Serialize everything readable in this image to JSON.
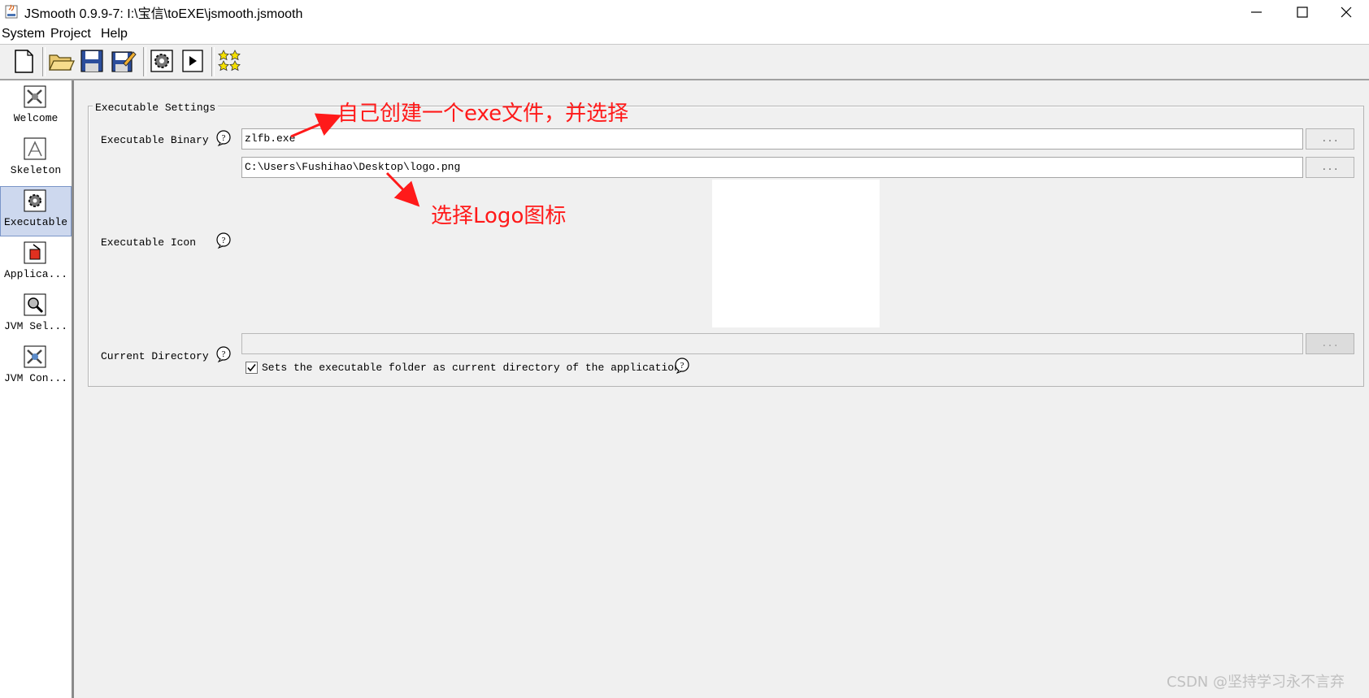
{
  "window": {
    "title": "JSmooth 0.9.9-7: I:\\宝信\\toEXE\\jsmooth.jsmooth",
    "controls": [
      "minimize",
      "maximize",
      "close"
    ]
  },
  "menu": {
    "items": [
      {
        "label": "System"
      },
      {
        "label": "Project"
      },
      {
        "label": "Help"
      }
    ]
  },
  "toolbar": {
    "buttons": [
      {
        "name": "new-file-icon"
      },
      {
        "name": "open-folder-icon"
      },
      {
        "name": "save-icon"
      },
      {
        "name": "save-as-icon"
      },
      {
        "name": "compile-gear-icon"
      },
      {
        "name": "run-icon"
      },
      {
        "name": "about-stars-icon"
      }
    ]
  },
  "sidebar": {
    "items": [
      {
        "label": "Welcome",
        "icon": "welcome-icon",
        "active": false
      },
      {
        "label": "Skeleton",
        "icon": "skeleton-icon",
        "active": false
      },
      {
        "label": "Executable",
        "icon": "executable-gear-icon",
        "active": true
      },
      {
        "label": "Applica...",
        "icon": "application-icon",
        "active": false
      },
      {
        "label": "JVM Sel...",
        "icon": "jvm-selection-icon",
        "active": false
      },
      {
        "label": "JVM Con...",
        "icon": "jvm-config-icon",
        "active": false
      }
    ]
  },
  "executable_settings": {
    "legend": "Executable Settings",
    "binary": {
      "label": "Executable Binary",
      "value": "zlfb.exe",
      "browse_label": "..."
    },
    "icon": {
      "label": "Executable Icon",
      "value": "C:\\Users\\Fushihao\\Desktop\\logo.png",
      "browse_label": "..."
    },
    "current_directory": {
      "label": "Current Directory",
      "value": "",
      "browse_label": "...",
      "checkbox_label": "Sets the executable folder as current directory of the application.",
      "checked": true
    }
  },
  "annotations": {
    "binary_note": "自己创建一个exe文件，并选择",
    "icon_note": "选择Logo图标",
    "color": "#ff1a1a"
  },
  "watermark": "CSDN @坚持学习永不言弃"
}
